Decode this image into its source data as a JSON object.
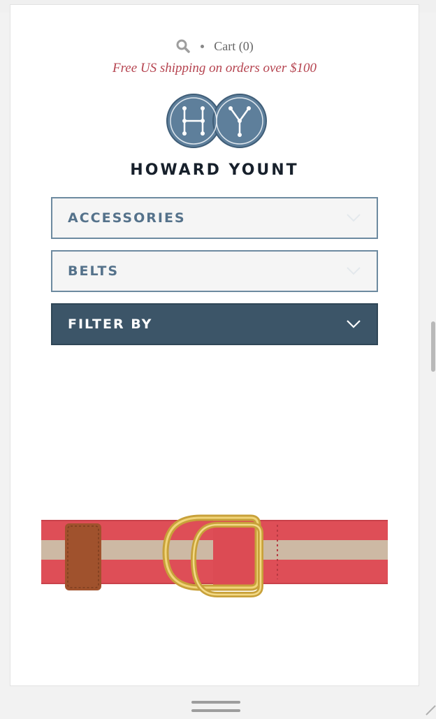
{
  "header": {
    "search_icon": "search-icon",
    "cart_label": "Cart (0)",
    "promo_text": "Free US shipping on orders over $100",
    "logo_letters": "HY",
    "brand_name": "HOWARD YOUNT"
  },
  "filters": [
    {
      "label": "ACCESSORIES",
      "icon": "chevron-down-icon"
    },
    {
      "label": "BELTS",
      "icon": "chevron-down-icon"
    },
    {
      "label": "FILTER BY",
      "icon": "chevron-down-icon"
    }
  ],
  "product": {
    "image": "red-and-khaki-striped-d-ring-belt"
  },
  "colors": {
    "accent": "#b5434f",
    "logo_blue": "#5e7f9b",
    "filter_dark": "#3c5568",
    "filter_border": "#6d8aa0",
    "belt_red": "#de4e57",
    "belt_stripe": "#cdb9a4"
  }
}
